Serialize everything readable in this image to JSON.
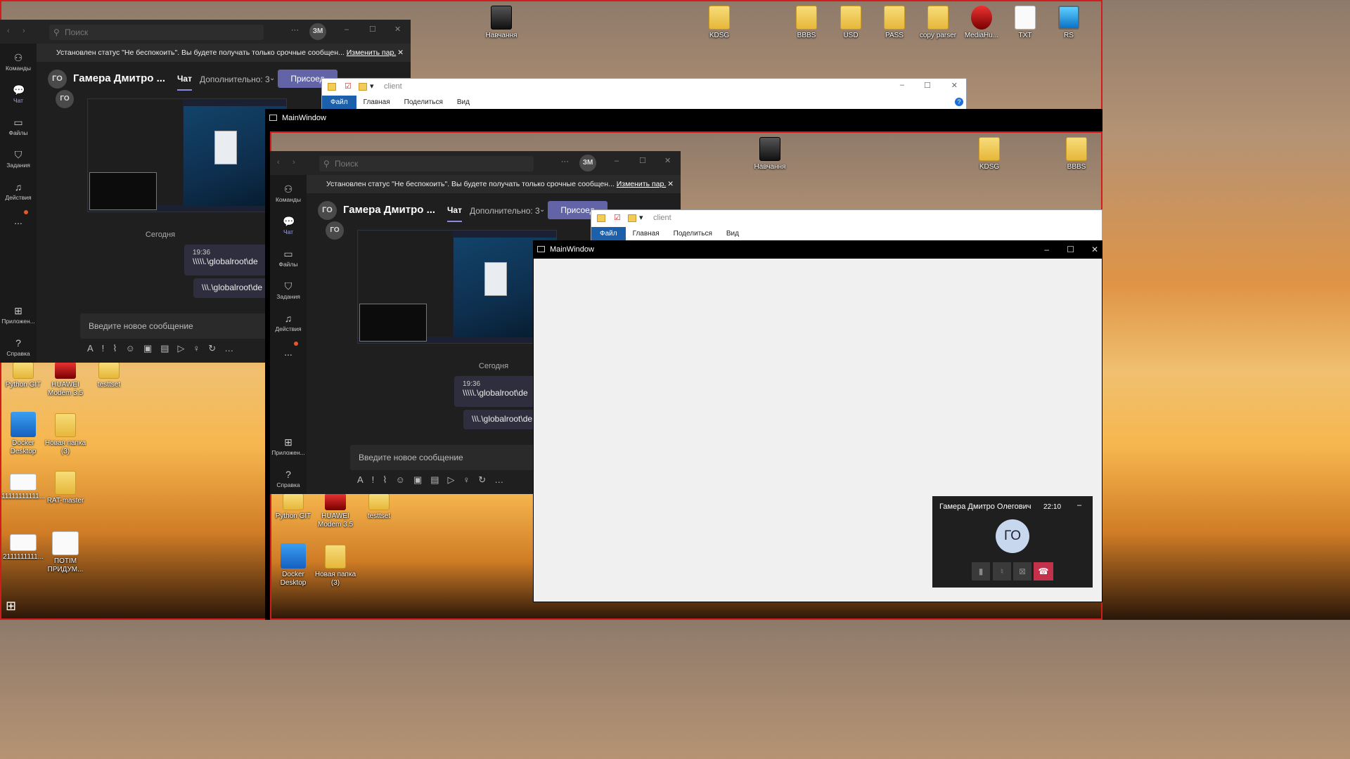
{
  "desktop": {
    "top_icons": [
      {
        "label": "Навчання",
        "kind": "dark"
      },
      {
        "label": "KDSG",
        "kind": "folder"
      },
      {
        "label": "BBBS",
        "kind": "folder"
      },
      {
        "label": "USD",
        "kind": "folder"
      },
      {
        "label": "PASS",
        "kind": "folder"
      },
      {
        "label": "copy parser",
        "kind": "folder"
      },
      {
        "label": "MediaHu...",
        "kind": "red"
      },
      {
        "label": "TXT",
        "kind": "doc"
      },
      {
        "label": "RS",
        "kind": "monitor"
      }
    ],
    "left_icons": [
      {
        "label": "Python GIT"
      },
      {
        "label": "HUAWEI Modem 3.5"
      },
      {
        "label": "testtset"
      },
      {
        "label": "Docker Desktop"
      },
      {
        "label": "Новая папка (3)"
      },
      {
        "label": "11111111111..."
      },
      {
        "label": "RAT-master"
      },
      {
        "label": "2111111111..."
      },
      {
        "label": "ПОТІМ ПРИДУМ..."
      }
    ]
  },
  "teams": {
    "search_placeholder": "Поиск",
    "user_initials": "ЗМ",
    "notice_text": "Установлен статус \"Не беспокоить\". Вы будете получать только срочные сообщен...",
    "notice_link": "Изменить пар.",
    "rail": {
      "teams": "Команды",
      "chat": "Чат",
      "files": "Файлы",
      "tasks": "Задания",
      "activity": "Действия",
      "more": "...",
      "apps": "Приложен...",
      "help": "Справка"
    },
    "chat_avatar": "ГО",
    "chat_name": "Гамера Дмитро ...",
    "tab_chat": "Чат",
    "tab_more": "Дополнительно: 3",
    "join_button": "Присоед",
    "date_divider": "Сегодня",
    "message_time": "19:36",
    "message_1": "\\\\\\\\\\.\\globalroot\\de",
    "message_2": "\\\\\\.\\globalroot\\de",
    "compose_placeholder": "Введите новое сообщение"
  },
  "explorer": {
    "title": "client",
    "tabs": [
      "Файл",
      "Главная",
      "Поделиться",
      "Вид"
    ]
  },
  "mainwindow": {
    "title": "MainWindow"
  },
  "call": {
    "name": "Гамера Дмитро Олегович",
    "time": "22:10",
    "initials": "ГО",
    "minimize": "–"
  },
  "colors": {
    "teams_accent": "#6264a7",
    "highlight_border": "#d21b1b",
    "end_call": "#c4314b"
  }
}
